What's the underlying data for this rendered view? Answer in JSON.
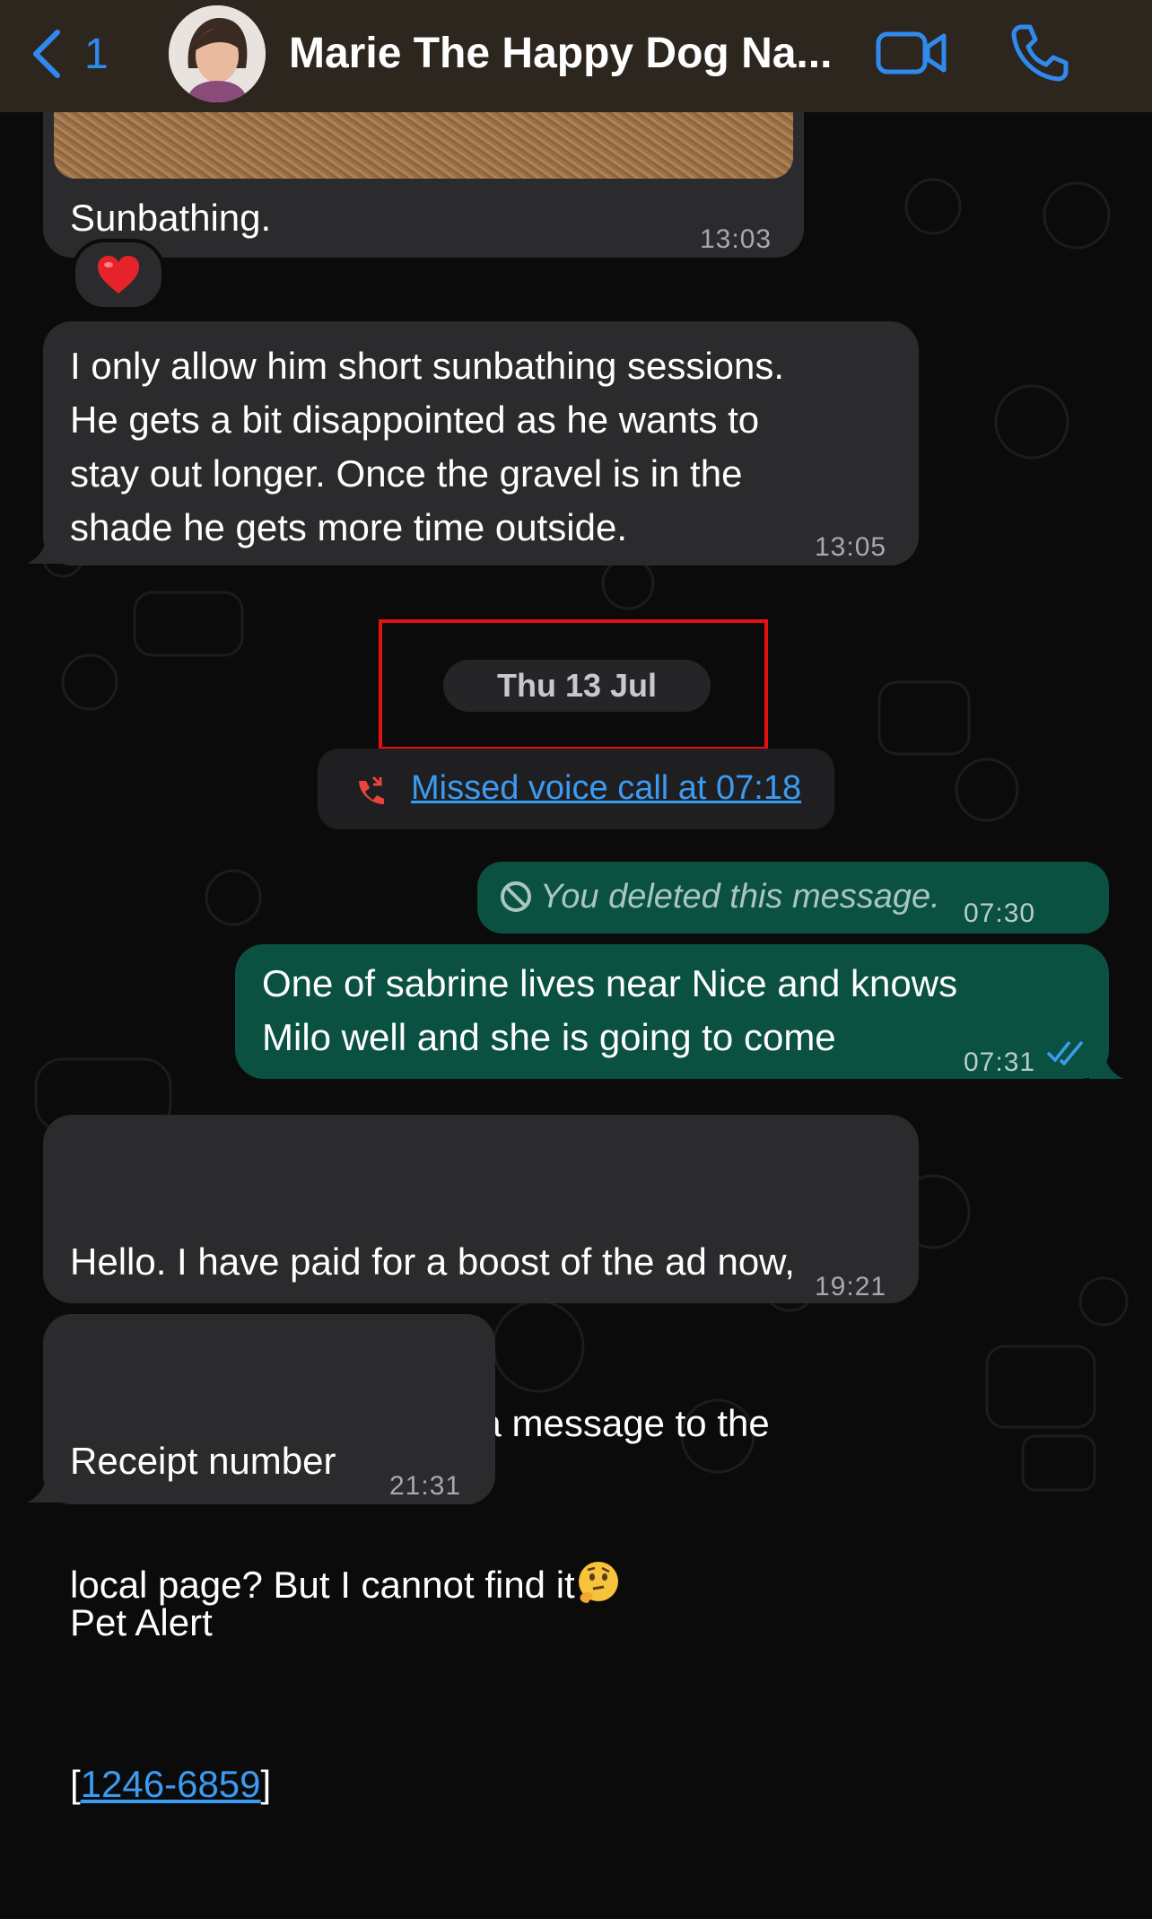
{
  "header": {
    "back_count": "1",
    "contact_name": "Marie The Happy Dog Na...",
    "accent_color": "#2f8af0",
    "icons": [
      "back-chevron-icon",
      "video-call-icon",
      "phone-call-icon"
    ]
  },
  "messages": [
    {
      "direction": "incoming",
      "text": "Sunbathing.",
      "time": "13:03",
      "has_photo": true,
      "reaction": "❤️"
    },
    {
      "direction": "incoming",
      "text": "I only allow him short sunbathing sessions.\nHe gets a bit disappointed as he wants to\nstay out longer. Once the gravel is in the\nshade he gets more time outside.",
      "time": "13:05"
    },
    {
      "direction": "system",
      "type": "date",
      "text": "Thu 13 Jul",
      "highlighted": true
    },
    {
      "direction": "system",
      "type": "missed-call",
      "text": "Missed voice call at 07:18",
      "icon": "missed-call-icon"
    },
    {
      "direction": "outgoing",
      "type": "deleted",
      "text": "You deleted this message.",
      "time": "07:30",
      "icon": "deleted-icon"
    },
    {
      "direction": "outgoing",
      "text": "One of sabrine lives near Nice and knows\nMilo well and she is going to come",
      "time": "07:31",
      "status": "read"
    },
    {
      "direction": "incoming",
      "text_lines": [
        "Hello. I have paid for a boost of the ad now,",
        "however, it says to write a message to the",
        "local page? But I cannot find it"
      ],
      "emoji": "thinking-face",
      "time": "19:21"
    },
    {
      "direction": "incoming",
      "lines": [
        "Receipt number",
        "Pet Alert"
      ],
      "link_prefix": "[",
      "link": "1246-6859",
      "link_suffix": "]",
      "time": "21:31"
    }
  ],
  "colors": {
    "incoming_bubble": "#2b2b2e",
    "outgoing_bubble": "#0a5142",
    "highlight_box": "#e01212",
    "link": "#3b9bf3",
    "missed_call": "#e8453c"
  }
}
